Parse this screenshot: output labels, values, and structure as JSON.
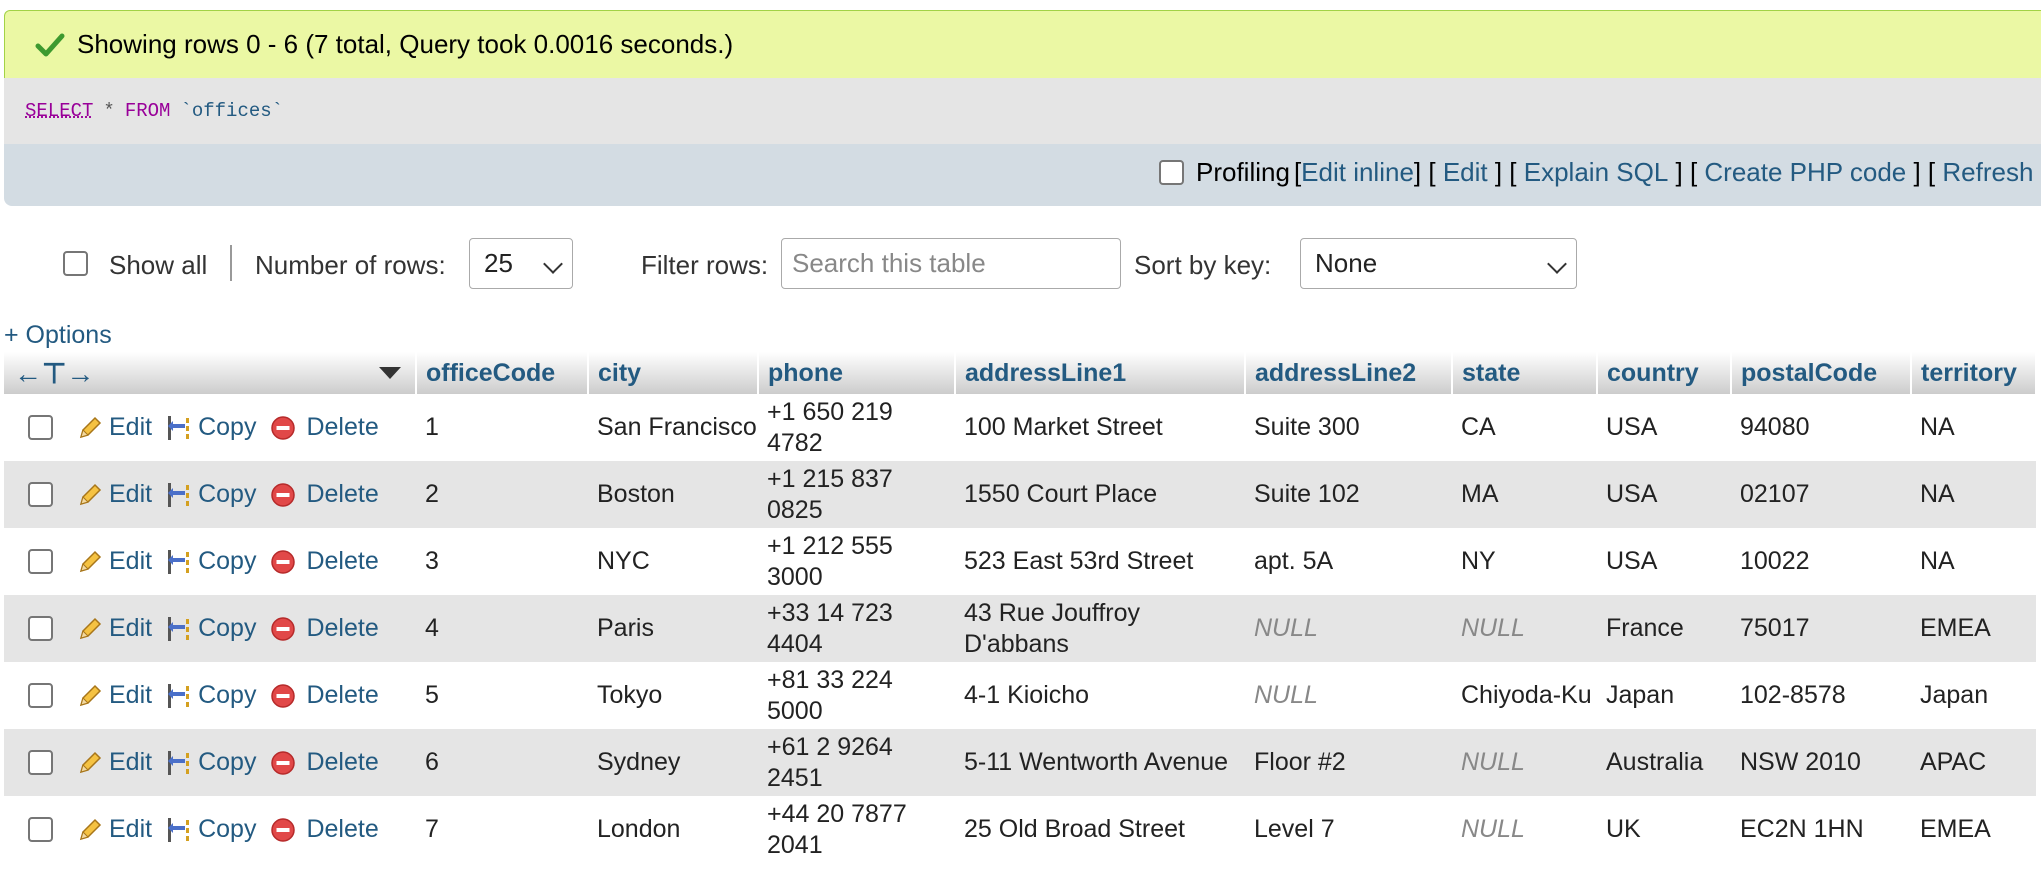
{
  "message": {
    "text": "Showing rows 0 - 6 (7 total, Query took 0.0016 seconds.)"
  },
  "sql": {
    "kw1": "SELECT",
    "star": "*",
    "kw2": "FROM",
    "table": "`offices`"
  },
  "tools": {
    "profiling": "Profiling",
    "edit_inline": "Edit inline",
    "edit": "Edit",
    "explain": "Explain SQL",
    "php": "Create PHP code",
    "refresh": "Refresh"
  },
  "nav": {
    "show_all": "Show all",
    "num_rows_label": "Number of rows:",
    "num_rows_value": "25",
    "filter_label": "Filter rows:",
    "filter_placeholder": "Search this table",
    "sort_label": "Sort by key:",
    "sort_value": "None"
  },
  "options_label": "+ Options",
  "table": {
    "columns": [
      "officeCode",
      "city",
      "phone",
      "addressLine1",
      "addressLine2",
      "state",
      "country",
      "postalCode",
      "territory"
    ],
    "actions": {
      "edit": "Edit",
      "copy": "Copy",
      "delete": "Delete"
    },
    "rows": [
      [
        "1",
        "San Francisco",
        "+1 650 219 4782",
        "100 Market Street",
        "Suite 300",
        "CA",
        "USA",
        "94080",
        "NA"
      ],
      [
        "2",
        "Boston",
        "+1 215 837 0825",
        "1550 Court Place",
        "Suite 102",
        "MA",
        "USA",
        "02107",
        "NA"
      ],
      [
        "3",
        "NYC",
        "+1 212 555 3000",
        "523 East 53rd Street",
        "apt. 5A",
        "NY",
        "USA",
        "10022",
        "NA"
      ],
      [
        "4",
        "Paris",
        "+33 14 723 4404",
        "43 Rue Jouffroy D'abbans",
        "NULL",
        "NULL",
        "France",
        "75017",
        "EMEA"
      ],
      [
        "5",
        "Tokyo",
        "+81 33 224 5000",
        "4-1 Kioicho",
        "NULL",
        "Chiyoda-Ku",
        "Japan",
        "102-8578",
        "Japan"
      ],
      [
        "6",
        "Sydney",
        "+61 2 9264 2451",
        "5-11 Wentworth Avenue",
        "Floor #2",
        "NULL",
        "Australia",
        "NSW 2010",
        "APAC"
      ],
      [
        "7",
        "London",
        "+44 20 7877 2041",
        "25 Old Broad Street",
        "Level 7",
        "NULL",
        "UK",
        "EC2N 1HN",
        "EMEA"
      ]
    ]
  }
}
